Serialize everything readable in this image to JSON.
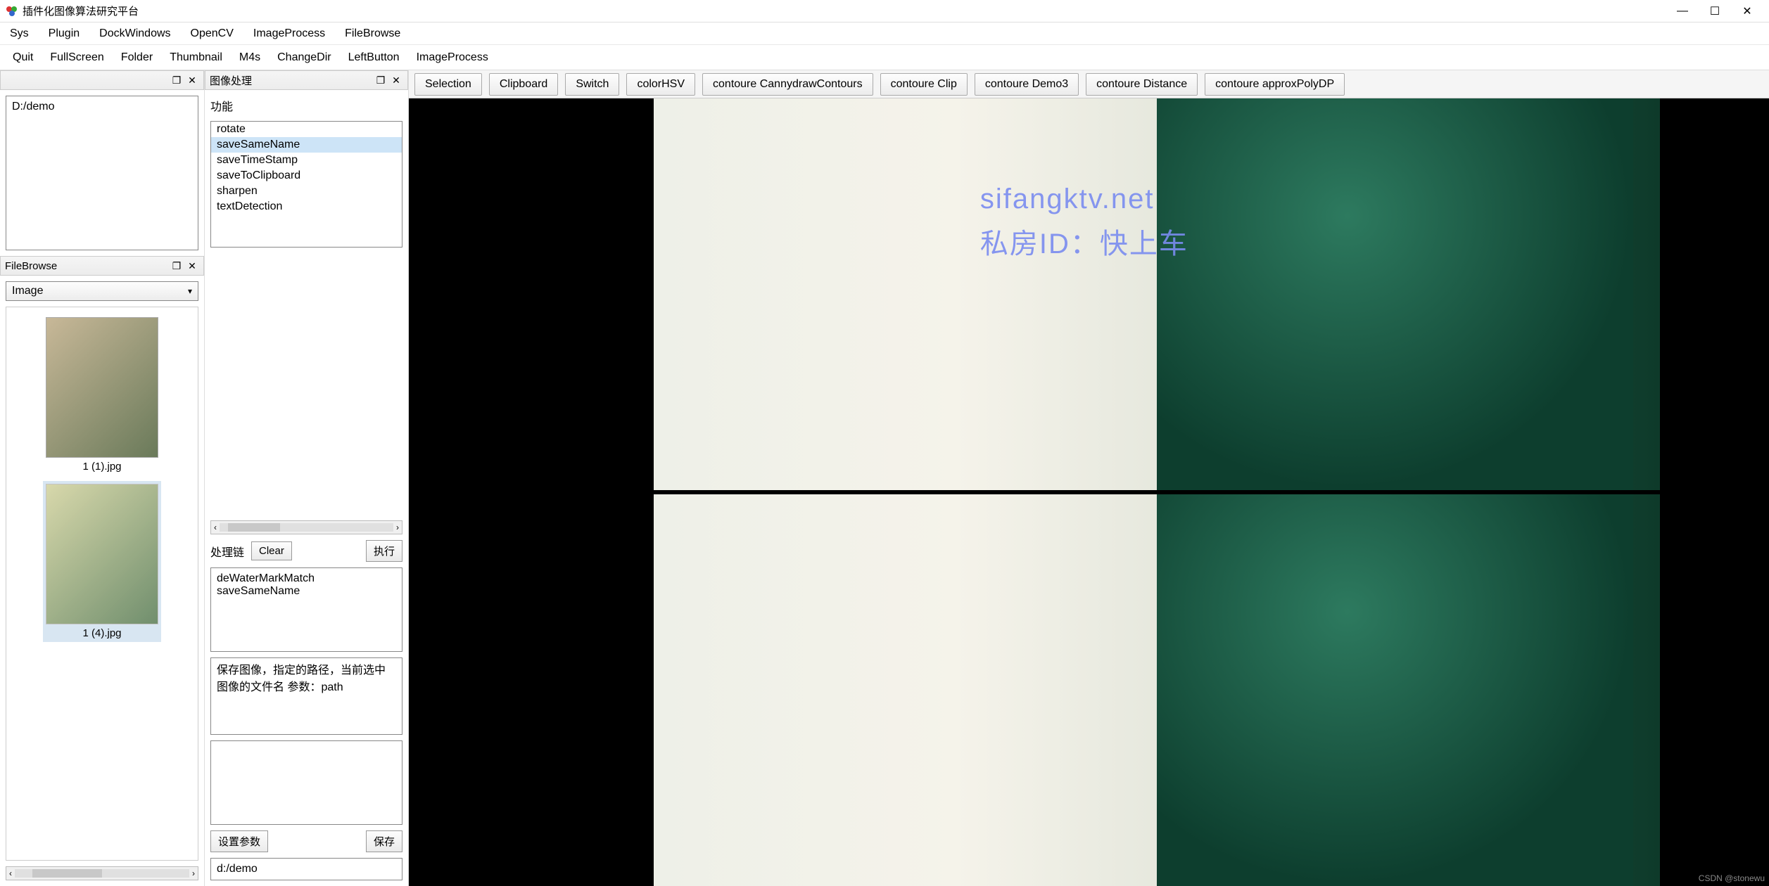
{
  "window": {
    "title": "插件化图像算法研究平台"
  },
  "menubar": [
    "Sys",
    "Plugin",
    "DockWindows",
    "OpenCV",
    "ImageProcess",
    "FileBrowse"
  ],
  "toolbar": [
    "Quit",
    "FullScreen",
    "Folder",
    "Thumbnail",
    "M4s",
    "ChangeDir",
    "LeftButton",
    "ImageProcess"
  ],
  "left": {
    "path_value": "D:/demo",
    "filebrowse_title": "FileBrowse",
    "combo_selected": "Image",
    "thumbs": [
      {
        "caption": "1 (1).jpg",
        "selected": false
      },
      {
        "caption": "1 (4).jpg",
        "selected": true
      }
    ]
  },
  "mid": {
    "header": "图像处理",
    "func_label": "功能",
    "func_items": [
      "rotate",
      "saveSameName",
      "saveTimeStamp",
      "saveToClipboard",
      "sharpen",
      "textDetection"
    ],
    "func_selected_index": 1,
    "chain_label": "处理链",
    "clear_btn": "Clear",
    "run_btn": "执行",
    "chain_items": [
      "deWaterMarkMatch",
      "saveSameName"
    ],
    "description": "保存图像，指定的路径，当前选中图像的文件名 参数：path",
    "set_param_btn": "设置参数",
    "save_btn": "保存",
    "path_input": "d:/demo"
  },
  "right": {
    "tabs": [
      "Selection",
      "Clipboard",
      "Switch",
      "colorHSV",
      "contoure CannydrawContours",
      "contoure Clip",
      "contoure Demo3",
      "contoure Distance",
      "contoure approxPolyDP"
    ],
    "watermark_line1": "sifangktv.net",
    "watermark_line2": "私房ID：快上车",
    "csdn": "CSDN @stonewu"
  }
}
